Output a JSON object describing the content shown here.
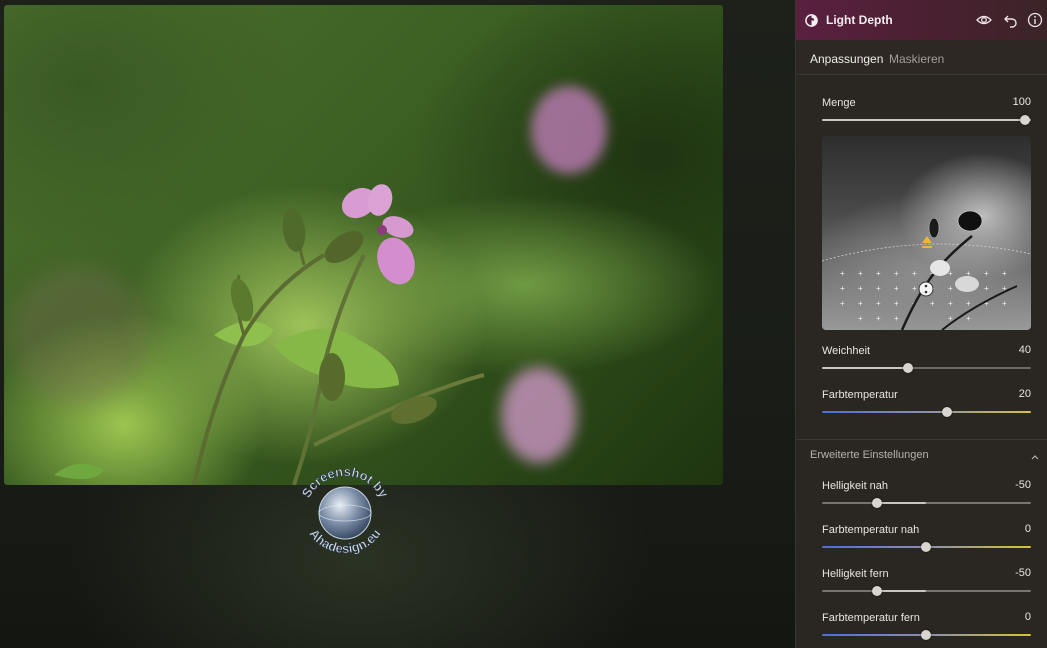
{
  "panel": {
    "title": "Light Depth",
    "icons": {
      "logo": "light-depth-logo-icon",
      "visibility": "eye-icon",
      "reset": "undo-icon",
      "info": "info-icon"
    },
    "tabs": [
      {
        "label": "Anpassungen",
        "active": true
      },
      {
        "label": "Maskieren",
        "active": false
      }
    ],
    "controls": {
      "menge": {
        "label": "Menge",
        "value": "100",
        "position": 1.0
      },
      "weichheit": {
        "label": "Weichheit",
        "value": "40",
        "position": 0.41
      },
      "farbtemperatur": {
        "label": "Farbtemperatur",
        "value": "20",
        "position": 0.6
      }
    },
    "advanced": {
      "header": "Erweiterte Einstellungen",
      "expanded": true,
      "controls": {
        "helligkeit_nah": {
          "label": "Helligkeit nah",
          "value": "-50",
          "position": 0.26
        },
        "farbtemperatur_nah": {
          "label": "Farbtemperatur nah",
          "value": "0",
          "position": 0.5
        },
        "helligkeit_fern": {
          "label": "Helligkeit fern",
          "value": "-50",
          "position": 0.26
        },
        "farbtemperatur_fern": {
          "label": "Farbtemperatur fern",
          "value": "0",
          "position": 0.5
        }
      }
    }
  },
  "watermark": {
    "text_top": "Screenshot by",
    "text_bottom": "Ahadesign.eu"
  },
  "colors": {
    "header_gradient_start": "#5a2040",
    "panel_bg": "#2a2622",
    "temp_cold": "#4c6fd6",
    "temp_warm": "#d6c23c"
  }
}
